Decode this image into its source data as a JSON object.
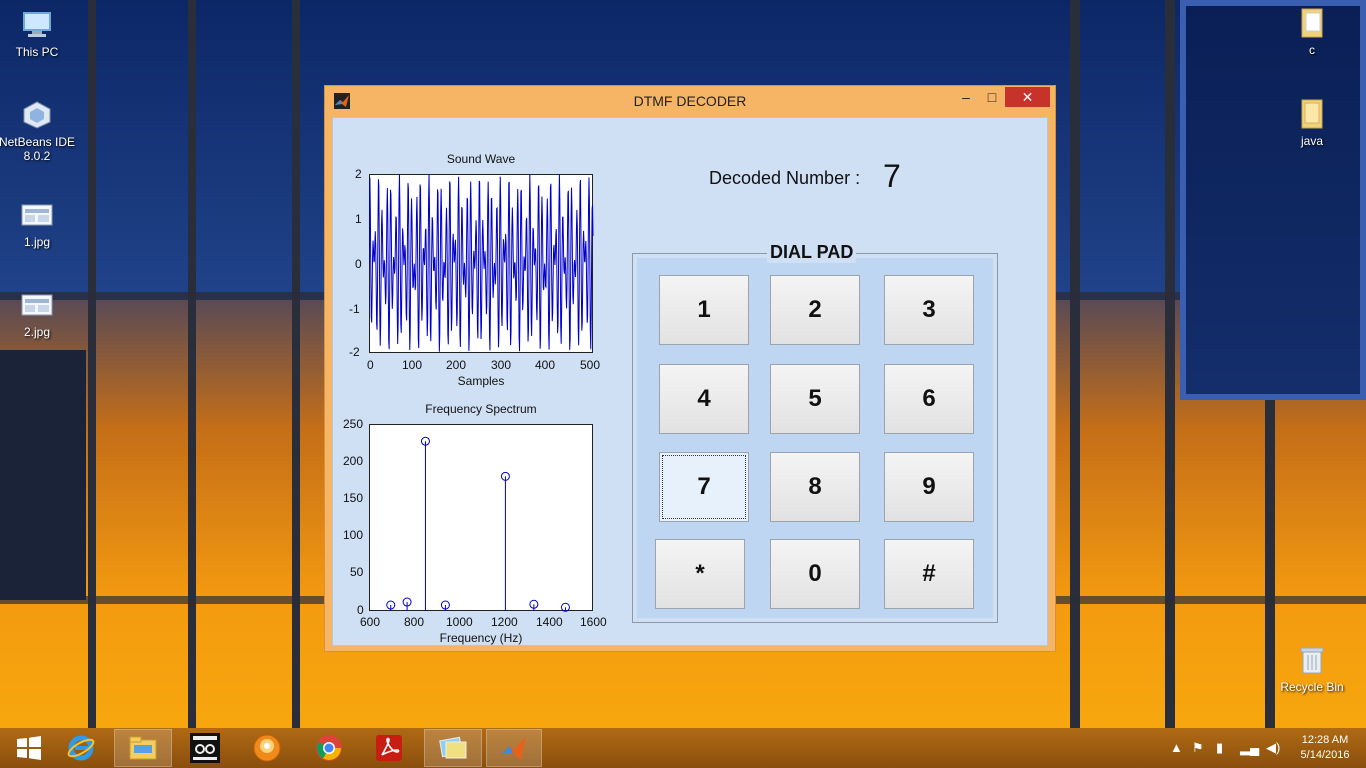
{
  "desktop": {
    "icons": [
      {
        "label": "This PC"
      },
      {
        "label": "NetBeans IDE\n8.0.2"
      },
      {
        "label": "1.jpg"
      },
      {
        "label": "2.jpg"
      },
      {
        "label": "c"
      },
      {
        "label": "java"
      },
      {
        "label": "Recycle Bin"
      }
    ]
  },
  "window": {
    "title": "DTMF DECODER",
    "minimize": "–",
    "maximize": "□",
    "close": "✕"
  },
  "sound_wave": {
    "title": "Sound Wave",
    "xlabel": "Samples",
    "x_ticks": [
      "0",
      "100",
      "200",
      "300",
      "400",
      "500"
    ],
    "y_ticks": [
      "2",
      "1",
      "0",
      "-1",
      "-2"
    ]
  },
  "spectrum": {
    "title": "Frequency Spectrum",
    "xlabel": "Frequency (Hz)",
    "x_ticks": [
      "600",
      "800",
      "1000",
      "1200",
      "1400",
      "1600"
    ],
    "y_ticks": [
      "250",
      "200",
      "150",
      "100",
      "50",
      "0"
    ]
  },
  "chart_data": [
    {
      "type": "line",
      "title": "Sound Wave",
      "xlabel": "Samples",
      "ylabel": "",
      "xlim": [
        0,
        500
      ],
      "ylim": [
        -2,
        2
      ],
      "series": [
        {
          "color": "#0000cc",
          "description_note": "",
          "frequencies_hz": [
            852,
            1209
          ],
          "samples": 500
        }
      ]
    },
    {
      "type": "scatter",
      "title": "Frequency Spectrum",
      "xlabel": "Frequency (Hz)",
      "ylabel": "",
      "xlim": [
        600,
        1600
      ],
      "ylim": [
        0,
        250
      ],
      "x": [
        697,
        770,
        852,
        941,
        1209,
        1336,
        1477
      ],
      "y": [
        8,
        12,
        227,
        8,
        180,
        9,
        5
      ]
    }
  ],
  "decoder": {
    "label": "Decoded Number :",
    "value": "7"
  },
  "dialpad": {
    "title": "DIAL PAD",
    "keys": [
      "1",
      "2",
      "3",
      "4",
      "5",
      "6",
      "7",
      "8",
      "9",
      "*",
      "0",
      "#"
    ],
    "active_key": "7"
  },
  "taskbar": {
    "time": "12:28 AM",
    "date": "5/14/2016"
  }
}
